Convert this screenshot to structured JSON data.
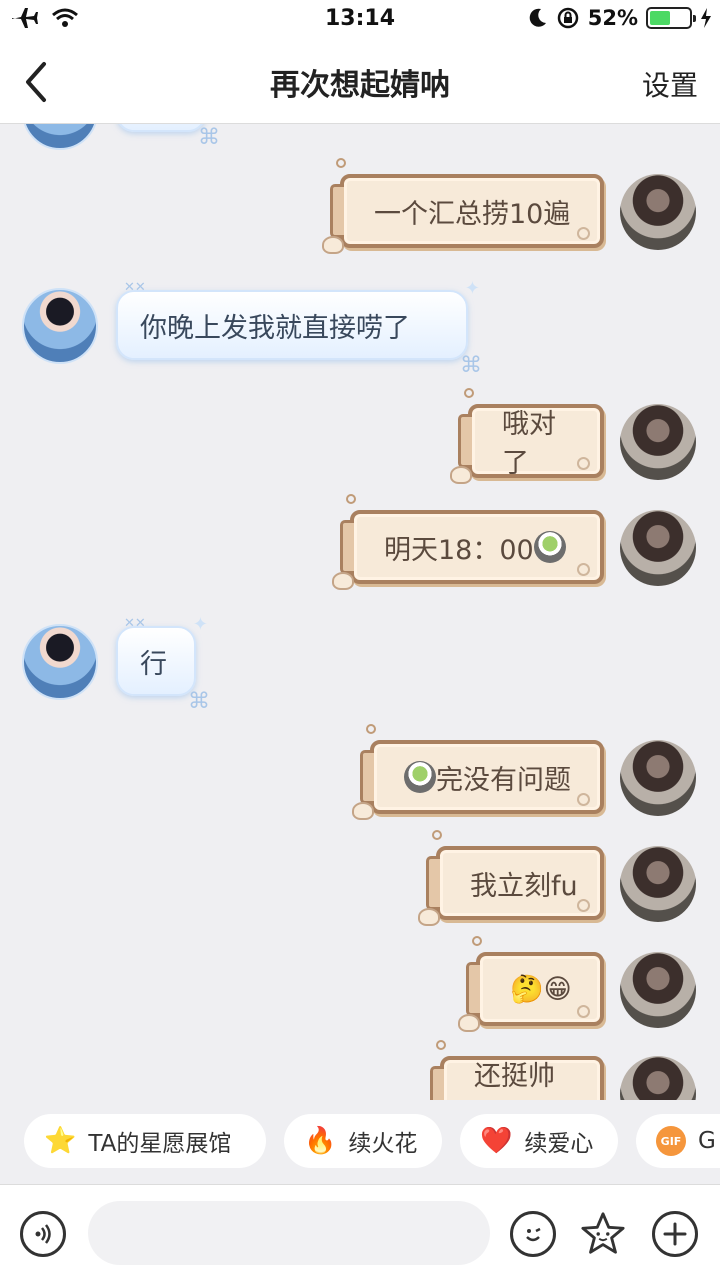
{
  "status_bar": {
    "time": "13:14",
    "battery": "52%",
    "battery_level": 0.52
  },
  "nav": {
    "title": "再次想起婧呐",
    "settings": "设置"
  },
  "messages": [
    {
      "from": "me",
      "text": "一个汇总捞10遍"
    },
    {
      "from": "them",
      "text": "你晚上发我就直接唠了"
    },
    {
      "from": "me",
      "text": "哦对了"
    },
    {
      "from": "me",
      "text": "明天18：00"
    },
    {
      "from": "them",
      "text": "行"
    },
    {
      "from": "me",
      "text": "完没有问题"
    },
    {
      "from": "me",
      "text": "我立刻fu"
    },
    {
      "from": "me",
      "text": "🤔😁"
    },
    {
      "from": "me",
      "text": "还挺帅的"
    }
  ],
  "quick_actions": [
    {
      "label": "TA的星愿展馆",
      "icon": "star-icon"
    },
    {
      "label": "续火花",
      "icon": "fire-icon"
    },
    {
      "label": "续爱心",
      "icon": "heart-icon"
    },
    {
      "label": "G",
      "icon": "gif-icon",
      "badge": "GIF"
    }
  ],
  "input": {
    "placeholder": ""
  }
}
